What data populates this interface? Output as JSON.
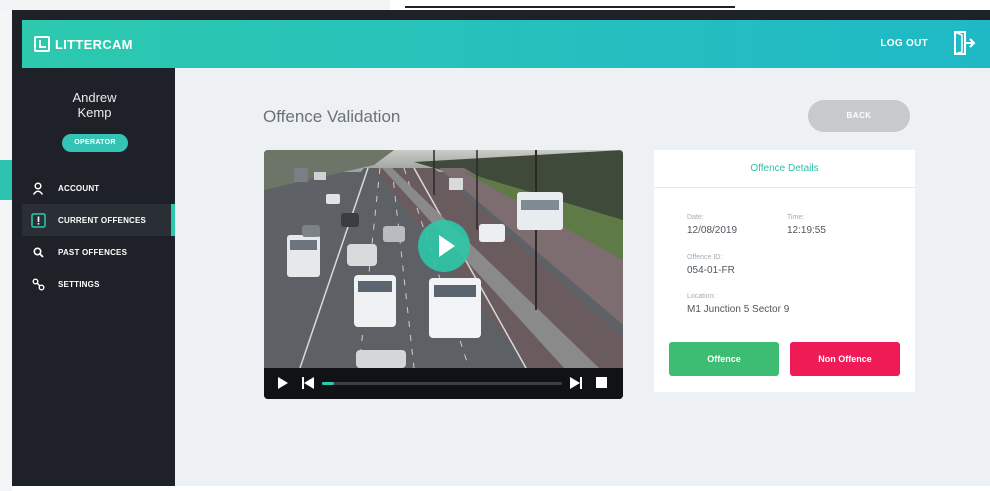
{
  "app": {
    "logo_text": "LITTERCAM",
    "logout_label": "LOG OUT"
  },
  "user": {
    "name": "Andrew Kemp",
    "role": "OPERATOR"
  },
  "nav": [
    {
      "label": "ACCOUNT",
      "icon": "user-icon",
      "active": false
    },
    {
      "label": "CURRENT OFFENCES",
      "icon": "alert-icon",
      "active": true
    },
    {
      "label": "PAST OFFENCES",
      "icon": "search-icon",
      "active": false
    },
    {
      "label": "SETTINGS",
      "icon": "settings-icon",
      "active": false
    }
  ],
  "page": {
    "title": "Offence Validation",
    "back_label": "BACK"
  },
  "video": {
    "progress": 0.05
  },
  "details": {
    "title": "Offence Details",
    "date_label": "Date:",
    "date": "12/08/2019",
    "time_label": "Time:",
    "time": "12:19:55",
    "id_label": "Offence ID:",
    "id": "054-01-FR",
    "location_label": "Location:",
    "location": "M1 Junction 5 Sector 9",
    "offence_btn": "Offence",
    "non_offence_btn": "Non Offence"
  },
  "colors": {
    "accent": "#2cc9ae",
    "sidebar": "#1e2228",
    "offence": "#3dbd73",
    "non_offence": "#ee1b57"
  }
}
